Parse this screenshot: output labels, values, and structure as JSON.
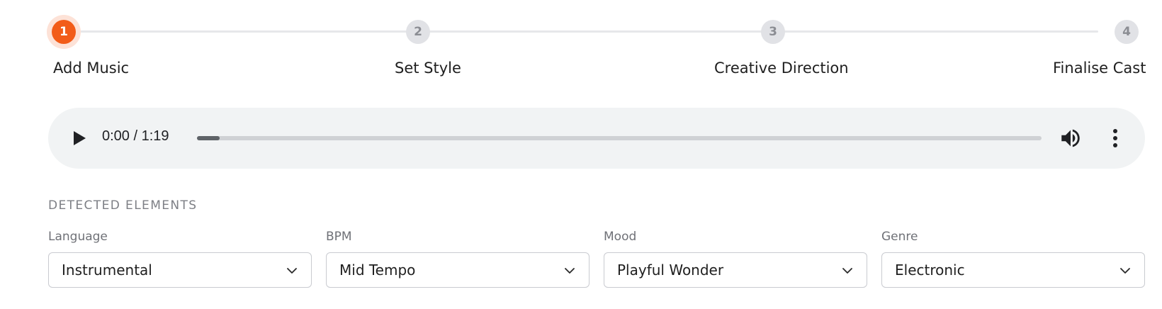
{
  "stepper": {
    "steps": [
      {
        "number": "1",
        "label": "Add Music",
        "active": true
      },
      {
        "number": "2",
        "label": "Set Style",
        "active": false
      },
      {
        "number": "3",
        "label": "Creative Direction",
        "active": false
      },
      {
        "number": "4",
        "label": "Finalise Cast",
        "active": false
      }
    ],
    "colors": {
      "active": "#f25c19",
      "inactive": "#e1e2e6"
    }
  },
  "audio_player": {
    "time": "0:00 / 1:19",
    "progress_fraction": 0.0,
    "icons": [
      "play-icon",
      "volume-icon",
      "more-vertical-icon"
    ]
  },
  "detected_elements": {
    "title": "DETECTED ELEMENTS",
    "fields": [
      {
        "label": "Language",
        "value": "Instrumental"
      },
      {
        "label": "BPM",
        "value": "Mid Tempo"
      },
      {
        "label": "Mood",
        "value": "Playful Wonder"
      },
      {
        "label": "Genre",
        "value": "Electronic"
      }
    ]
  }
}
